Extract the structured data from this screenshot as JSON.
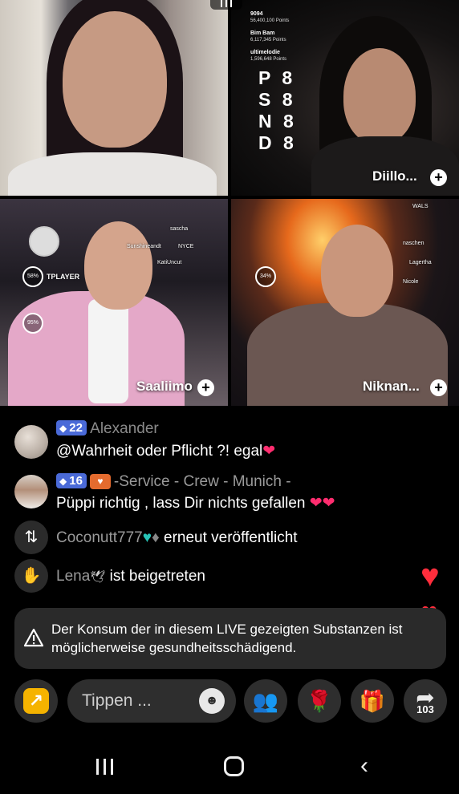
{
  "tiles": [
    {
      "name": "",
      "type": "guest"
    },
    {
      "name": "Diillo...",
      "type": "guest",
      "ranks": [
        "P 8",
        "S 8",
        "N 8",
        "D 8"
      ],
      "leaderboard": [
        {
          "name": "9094",
          "points": "56,400,100 Points"
        },
        {
          "name": "Bim Bam",
          "points": "6,117,345 Points"
        },
        {
          "name": "ultimelodie",
          "points": "1,596,648 Points"
        }
      ]
    },
    {
      "name": "Saaliimo",
      "type": "guest",
      "overlay_labels": [
        "sascha",
        "Sunshineandt",
        "NYCE",
        "KatiUncut",
        "TPLAYER",
        "58%",
        "95%"
      ]
    },
    {
      "name": "Niknan...",
      "type": "guest",
      "overlay_labels": [
        "WALS",
        "naschen",
        "Lagertha",
        "Nicole",
        "34%"
      ]
    }
  ],
  "chat": [
    {
      "user": "Alexander",
      "level": "22",
      "text": "@Wahrheit oder Pflicht ?! egal",
      "emoji": "❤"
    },
    {
      "user": "-Service - Crew - Munich -",
      "level": "16",
      "text": "Püppi richtig , lass Dir nichts gefallen",
      "emoji": "❤❤"
    },
    {
      "user": "Coconutt777",
      "event": "erneut veröffentlicht",
      "icon": "repost-icon"
    },
    {
      "user": "Lena",
      "event": "ist beigetreten",
      "icon": "wave-icon"
    }
  ],
  "warning": {
    "text": "Der Konsum der in diesem LIVE gezeigten Substanzen ist möglicherweise gesundheitsschädigend."
  },
  "toolbar": {
    "input_placeholder": "Tippen ...",
    "share_count": "103"
  },
  "colors": {
    "accent_pink": "#ff2d6f",
    "level_badge": "#4a6ad8",
    "share_yellow": "#f5b300",
    "warning_bg": "#2a2a2a"
  }
}
